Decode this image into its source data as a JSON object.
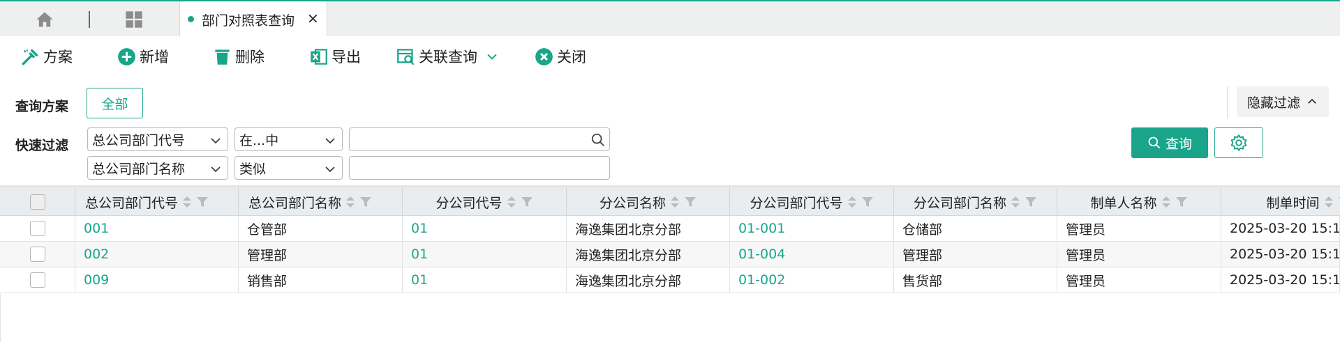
{
  "tabbar": {
    "active_tab_label": "部门对照表查询",
    "close_glyph": "✕"
  },
  "toolbar": {
    "scheme_label": "方案",
    "add_label": "新增",
    "delete_label": "删除",
    "export_label": "导出",
    "related_query_label": "关联查询",
    "close_label": "关闭"
  },
  "filter": {
    "scheme_label": "查询方案",
    "all_button": "全部",
    "hide_filter_label": "隐藏过滤",
    "quick_filter_label": "快速过滤",
    "rows": [
      {
        "field": "总公司部门代号",
        "operator": "在...中",
        "value": ""
      },
      {
        "field": "总公司部门名称",
        "operator": "类似",
        "value": ""
      }
    ],
    "query_button": "查询"
  },
  "grid": {
    "columns": [
      "总公司部门代号",
      "总公司部门名称",
      "分公司代号",
      "分公司名称",
      "分公司部门代号",
      "分公司部门名称",
      "制单人名称",
      "制单时间"
    ],
    "rows": [
      [
        "001",
        "仓管部",
        "01",
        "海逸集团北京分部",
        "01-001",
        "仓储部",
        "管理员",
        "2025-03-20 15:1"
      ],
      [
        "002",
        "管理部",
        "01",
        "海逸集团北京分部",
        "01-004",
        "管理部",
        "管理员",
        "2025-03-20 15:1"
      ],
      [
        "009",
        "销售部",
        "01",
        "海逸集团北京分部",
        "01-002",
        "售货部",
        "管理员",
        "2025-03-20 15:1"
      ]
    ]
  },
  "colors": {
    "accent": "#1aa58a",
    "header_bg": "#e9edf0",
    "tabbar_bg": "#eef0ef"
  },
  "icons": [
    "home-icon",
    "grid-icon",
    "scheme-icon",
    "add-circle-icon",
    "trash-icon",
    "excel-icon",
    "related-query-icon",
    "chevron-down-icon",
    "close-circle-icon",
    "chevron-up-icon",
    "search-icon",
    "gear-icon",
    "sort-icon",
    "filter-icon"
  ]
}
